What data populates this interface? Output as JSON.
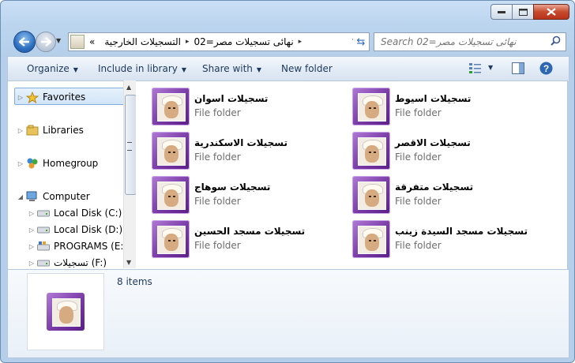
{
  "window": {
    "controls": {
      "minimize": "minimize-icon",
      "maximize": "maximize-icon",
      "close": "close-icon"
    }
  },
  "address": {
    "root_symbol": "«",
    "crumbs": [
      "التسجيلات الخارجية",
      "نهائى تسجيلات مصر=02"
    ],
    "separator": "▸"
  },
  "search": {
    "placeholder": "Search نهائى تسجيلات مصر=02"
  },
  "toolbar": {
    "organize": "Organize",
    "include": "Include in library",
    "share": "Share with",
    "new_folder": "New folder"
  },
  "nav": {
    "favorites": "Favorites",
    "libraries": "Libraries",
    "homegroup": "Homegroup",
    "computer": "Computer",
    "drives": [
      "Local Disk (C:)",
      "Local Disk (D:)",
      "PROGRAMS (E:)",
      "تسجيلات (F:)"
    ]
  },
  "items": [
    {
      "name": "تسجيلات اسوان",
      "type": "File folder"
    },
    {
      "name": "تسجيلات اسيوط",
      "type": "File folder"
    },
    {
      "name": "تسجيلات الاسكندرية",
      "type": "File folder"
    },
    {
      "name": "تسجيلات الاقصر",
      "type": "File folder"
    },
    {
      "name": "تسجيلات سوهاج",
      "type": "File folder"
    },
    {
      "name": "تسجيلات متفرقة",
      "type": "File folder"
    },
    {
      "name": "تسجيلات مسجد الحسين",
      "type": "File folder"
    },
    {
      "name": "تسجيلات مسجد السيدة زينب",
      "type": "File folder"
    }
  ],
  "details": {
    "count": "8 items"
  },
  "colors": {
    "accent": "#2c6fbf",
    "thumb": "#7a3aa6"
  }
}
